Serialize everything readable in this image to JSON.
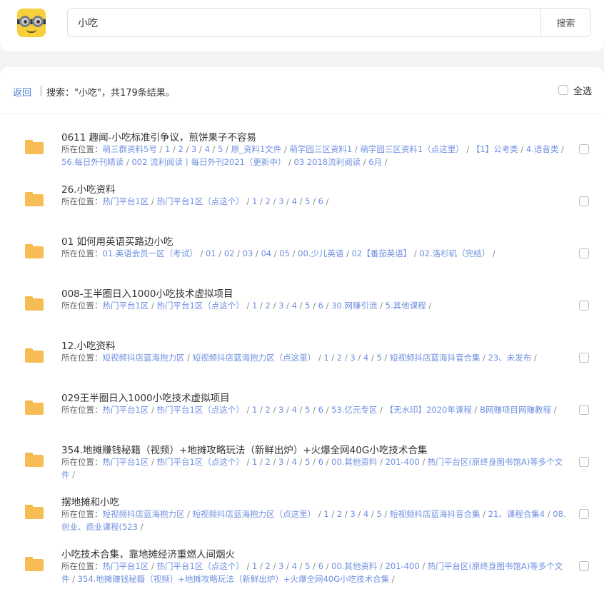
{
  "header": {
    "search_value": "小吃",
    "search_button": "搜索"
  },
  "toolbar": {
    "back": "返回",
    "summary": "搜索：\"小吃\"，共179条结果。",
    "select_all": "全选"
  },
  "path_label": "所在位置：",
  "results": [
    {
      "title": "0611 趣闻-小吃标准引争议，煎饼果子不容易",
      "path": [
        "萌三群资料5号",
        "1",
        "2",
        "3",
        "4",
        "5",
        "原_资料1文件",
        "萌学园三区资料1",
        "萌学园三区资料1（点这里）",
        "【1】公考类",
        "4.语音类",
        "56.每日外刊精读",
        "002 流利阅读丨每日外刊2021（更新中）",
        "03 2018流利阅读",
        "6月"
      ]
    },
    {
      "title": "26.小吃资料",
      "path": [
        "热门平台1区",
        "热门平台1区（点这个）",
        "1",
        "2",
        "3",
        "4",
        "5",
        "6"
      ]
    },
    {
      "title": "01 如何用英语买路边小吃",
      "path": [
        "01.英语会员一区（考试）",
        "01",
        "02",
        "03",
        "04",
        "05",
        "00.少儿英语",
        "02【番茄英语】",
        "02.洛杉矶（完结）"
      ]
    },
    {
      "title": "008-王半圈日入1000小吃技术虚拟项目",
      "path": [
        "热门平台1区",
        "热门平台1区（点这个）",
        "1",
        "2",
        "3",
        "4",
        "5",
        "6",
        "30.网赚引流",
        "5.其他课程"
      ]
    },
    {
      "title": "12.小吃资料",
      "path": [
        "短视频抖店蓝海抱力区",
        "短视频抖店蓝海抱力区（点这里）",
        "1",
        "2",
        "3",
        "4",
        "5",
        "短视频抖店蓝海抖音合集",
        "23、未发布"
      ]
    },
    {
      "title": "029王半圈日入1000小吃技术虚拟项目",
      "path": [
        "热门平台1区",
        "热门平台1区（点这个）",
        "1",
        "2",
        "3",
        "4",
        "5",
        "6",
        "53.亿元专区",
        "【无水印】2020年课程",
        "B网赚项目网赚教程"
      ]
    },
    {
      "title": "354.地摊赚钱秘籍（视频）+地摊攻略玩法（新鲜出炉）+火爆全网40G小吃技术合集",
      "path": [
        "热门平台1区",
        "热门平台1区（点这个）",
        "1",
        "2",
        "3",
        "4",
        "5",
        "6",
        "00.其他资料",
        "201-400",
        "热门平台区(原终身图书馆A)等多个文件"
      ]
    },
    {
      "title": "摆地摊和小吃",
      "path": [
        "短视频抖店蓝海抱力区",
        "短视频抖店蓝海抱力区（点这里）",
        "1",
        "2",
        "3",
        "4",
        "5",
        "短视频抖店蓝海抖音合集",
        "21、课程合集4",
        "08.创业、商业课程(523"
      ]
    },
    {
      "title": "小吃技术合集，靠地摊经济重燃人间烟火",
      "path": [
        "热门平台1区",
        "热门平台1区（点这个）",
        "1",
        "2",
        "3",
        "4",
        "5",
        "6",
        "00.其他资料",
        "201-400",
        "热门平台区(原终身图书馆A)等多个文件",
        "354.地摊赚钱秘籍（视频）+地摊攻略玩法（新鲜出炉）+火爆全网40G小吃技术合集"
      ]
    }
  ]
}
